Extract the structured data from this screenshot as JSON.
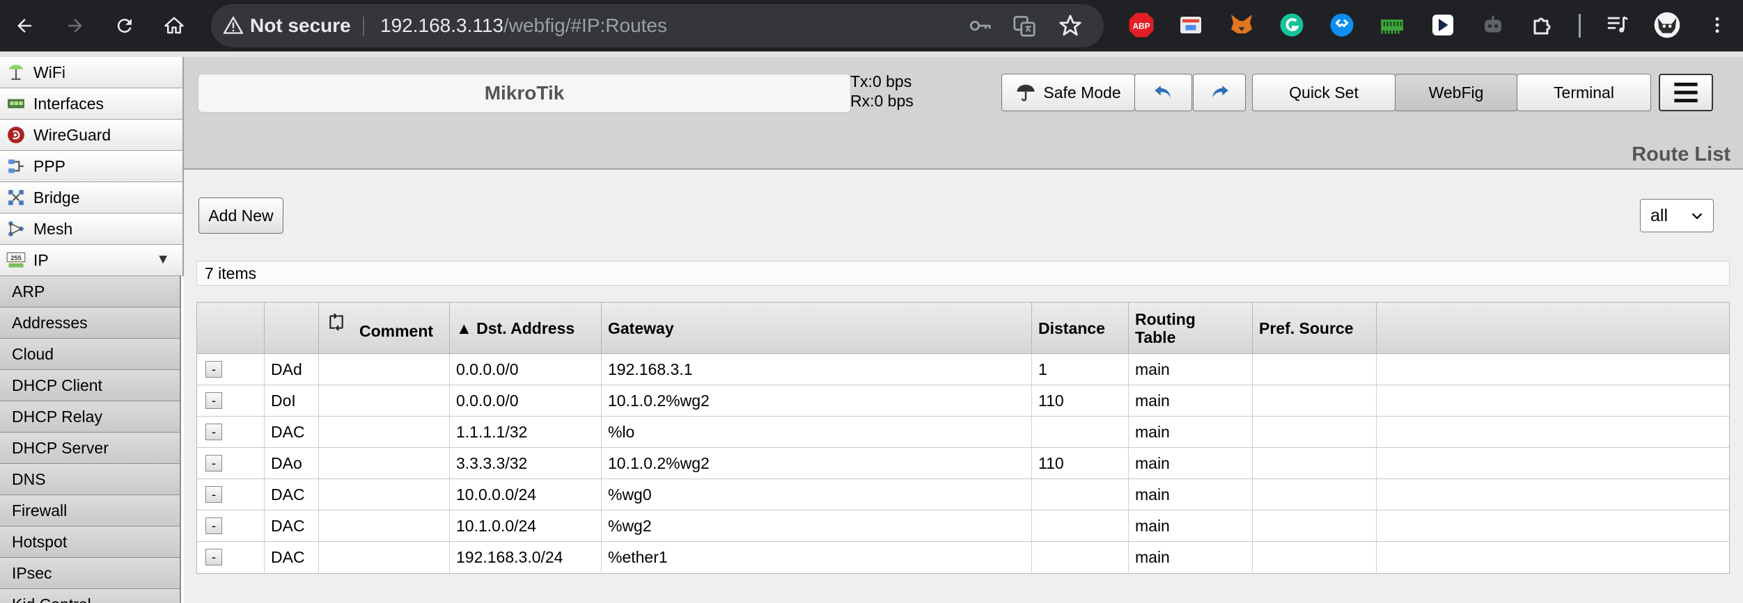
{
  "browser": {
    "security_label": "Not secure",
    "url_host": "192.168.3.113",
    "url_path": "/webfig/#IP:Routes",
    "extensions": [
      "abp-icon",
      "extension-icon",
      "metamask-fox-icon",
      "grammarly-icon",
      "shazam-icon",
      "ram-icon",
      "extension-icon",
      "robot-icon",
      "puzzle-icon",
      "media-queue-icon",
      "profile-avatar"
    ],
    "abp_label": "ABP"
  },
  "sidebar": {
    "items": [
      {
        "label": "WiFi",
        "icon": "wifi-icon"
      },
      {
        "label": "Interfaces",
        "icon": "interfaces-icon"
      },
      {
        "label": "WireGuard",
        "icon": "wireguard-icon"
      },
      {
        "label": "PPP",
        "icon": "ppp-icon"
      },
      {
        "label": "Bridge",
        "icon": "bridge-icon"
      },
      {
        "label": "Mesh",
        "icon": "mesh-icon"
      },
      {
        "label": "IP",
        "icon": "ip-icon",
        "arrow": "▼"
      }
    ],
    "ip_icon_text": "255",
    "sub_items": [
      "ARP",
      "Addresses",
      "Cloud",
      "DHCP Client",
      "DHCP Relay",
      "DHCP Server",
      "DNS",
      "Firewall",
      "Hotspot",
      "IPsec",
      "Kid Control"
    ]
  },
  "header": {
    "title": "MikroTik",
    "tx": "Tx:0 bps",
    "rx": "Rx:0 bps",
    "safe_mode": "Safe Mode",
    "quick_set": "Quick Set",
    "webfig": "WebFig",
    "terminal": "Terminal"
  },
  "page": {
    "heading": "Route List",
    "add_new": "Add New",
    "filter_value": "all",
    "item_count": "7 items"
  },
  "table": {
    "columns": {
      "comment": "Comment",
      "dst": "▲ Dst. Address",
      "gateway": "Gateway",
      "distance": "Distance",
      "routing_table": "Routing Table",
      "pref_source": "Pref. Source"
    },
    "remove_label": "-",
    "rows": [
      {
        "flags": "DAd",
        "comment": "",
        "dst": "0.0.0.0/0",
        "gateway": "192.168.3.1",
        "distance": "1",
        "table": "main",
        "pref": ""
      },
      {
        "flags": "DoI",
        "comment": "",
        "dst": "0.0.0.0/0",
        "gateway": "10.1.0.2%wg2",
        "distance": "110",
        "table": "main",
        "pref": ""
      },
      {
        "flags": "DAC",
        "comment": "",
        "dst": "1.1.1.1/32",
        "gateway": "%lo",
        "distance": "",
        "table": "main",
        "pref": ""
      },
      {
        "flags": "DAo",
        "comment": "",
        "dst": "3.3.3.3/32",
        "gateway": "10.1.0.2%wg2",
        "distance": "110",
        "table": "main",
        "pref": ""
      },
      {
        "flags": "DAC",
        "comment": "",
        "dst": "10.0.0.0/24",
        "gateway": "%wg0",
        "distance": "",
        "table": "main",
        "pref": ""
      },
      {
        "flags": "DAC",
        "comment": "",
        "dst": "10.1.0.0/24",
        "gateway": "%wg2",
        "distance": "",
        "table": "main",
        "pref": ""
      },
      {
        "flags": "DAC",
        "comment": "",
        "dst": "192.168.3.0/24",
        "gateway": "%ether1",
        "distance": "",
        "table": "main",
        "pref": ""
      }
    ]
  }
}
